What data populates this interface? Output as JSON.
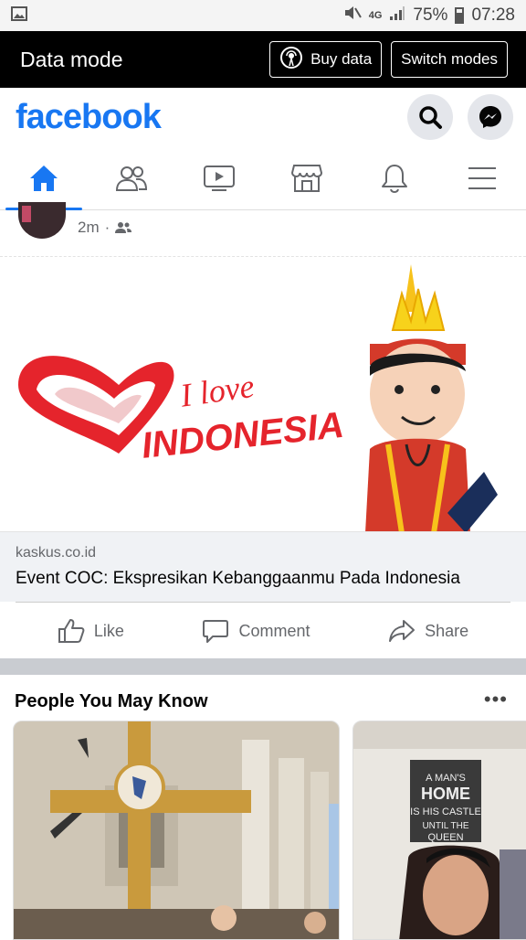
{
  "status_bar": {
    "battery": "75%",
    "time": "07:28",
    "network": "4G"
  },
  "data_mode": {
    "title": "Data mode",
    "buy_label": "Buy data",
    "switch_label": "Switch modes"
  },
  "header": {
    "logo": "facebook"
  },
  "nav": {
    "tabs": [
      "home",
      "friends",
      "watch",
      "marketplace",
      "notifications",
      "menu"
    ],
    "active": "home"
  },
  "post": {
    "time": "2m",
    "link_domain": "kaskus.co.id",
    "link_title": "Event COC: Ekspresikan Kebanggaanmu Pada Indonesia",
    "image_text": {
      "line1": "I love",
      "line2": "INDONESIA"
    },
    "actions": {
      "like": "Like",
      "comment": "Comment",
      "share": "Share"
    }
  },
  "people_you_may_know": {
    "title": "People You May Know",
    "more": "•••",
    "sign_text": "A MAN'S HOME IS HIS CASTLE UNTIL THE QUEEN"
  },
  "colors": {
    "brand": "#1877f2",
    "red": "#e5242c"
  }
}
